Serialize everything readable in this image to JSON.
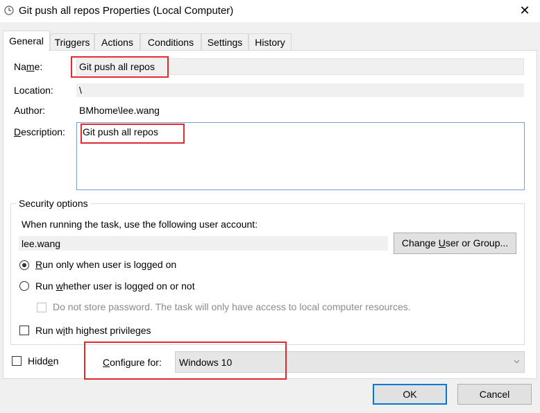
{
  "window": {
    "title": "Git push all repos Properties (Local Computer)",
    "close_glyph": "✕"
  },
  "tabs": [
    {
      "label": "General",
      "active": true
    },
    {
      "label": "Triggers"
    },
    {
      "label": "Actions"
    },
    {
      "label": "Conditions"
    },
    {
      "label": "Settings"
    },
    {
      "label": "History"
    }
  ],
  "general": {
    "name_label_pre": "Na",
    "name_label_u": "m",
    "name_label_post": "e:",
    "name_value": "Git push all repos",
    "location_label": "Location:",
    "location_value": "\\",
    "author_label": "Author:",
    "author_value": "BMhome\\lee.wang",
    "description_label_u": "D",
    "description_label_post": "escription:",
    "description_value": "Git push all repos"
  },
  "security": {
    "group_title": "Security options",
    "account_prompt": "When running the task, use the following user account:",
    "account_value": "lee.wang",
    "change_button_pre": "Change ",
    "change_button_u": "U",
    "change_button_post": "ser or Group...",
    "run_logged_on_u": "R",
    "run_logged_on_post": "un only when user is logged on",
    "run_whether_pre": "Run ",
    "run_whether_u": "w",
    "run_whether_post": "hether user is logged on or not",
    "do_not_store": "Do not store password.  The task will only have access to local computer resources.",
    "highest_pre": "Run w",
    "highest_u": "i",
    "highest_post": "th highest privileges",
    "selected_option": "run_only_when_logged_on"
  },
  "bottom": {
    "hidden_pre": "Hidd",
    "hidden_u": "e",
    "hidden_post": "n",
    "configure_pre": "",
    "configure_u": "C",
    "configure_post": "onfigure for:",
    "configure_value": "Windows 10",
    "ok_label": "OK",
    "cancel_label": "Cancel"
  },
  "colors": {
    "highlight_box": "#e02a2f",
    "default_button_border": "#0078d7"
  }
}
